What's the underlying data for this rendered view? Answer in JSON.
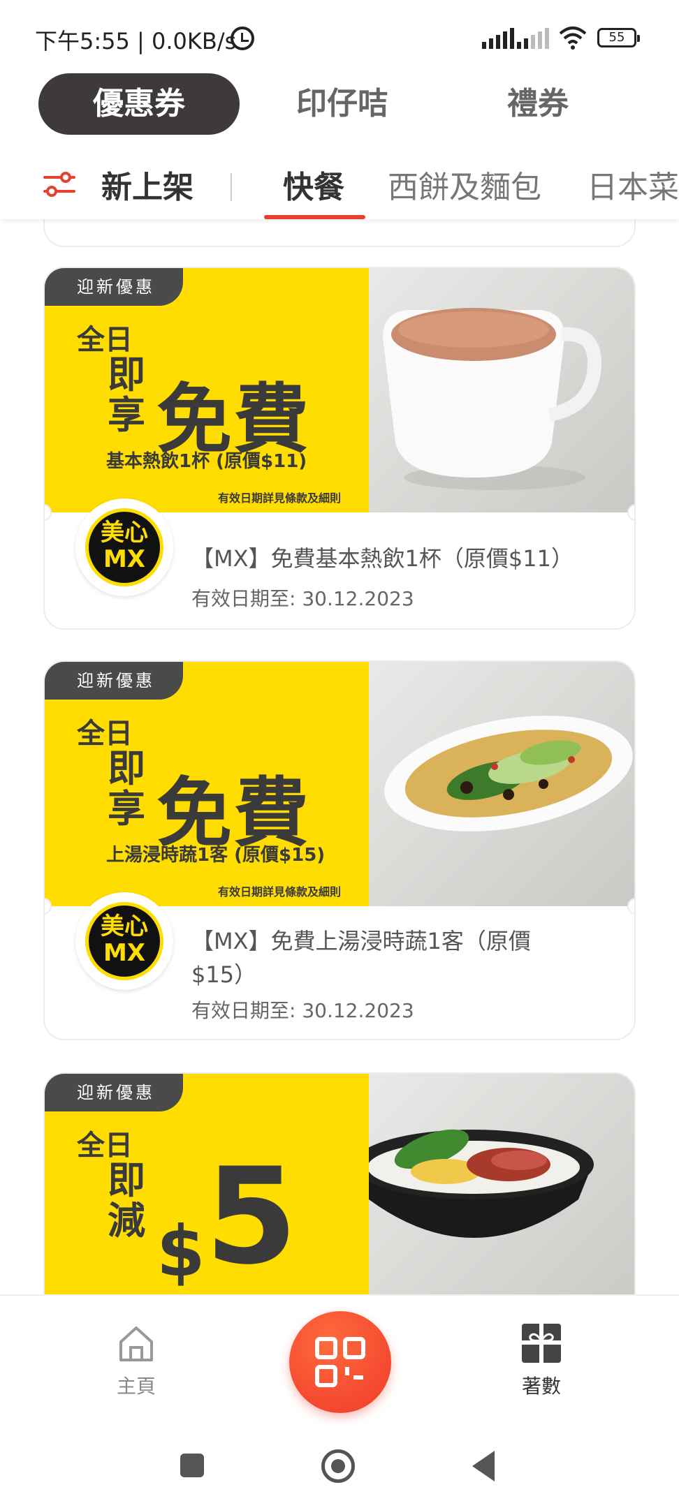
{
  "status_bar": {
    "time_speed": "下午5:55 | 0.0KB/s",
    "battery": "55",
    "icons": [
      "alarm-icon",
      "signal-icon",
      "signal-icon",
      "wifi-icon",
      "battery-icon"
    ]
  },
  "top_tabs": [
    {
      "label": "優惠券",
      "active": true
    },
    {
      "label": "印仔咭",
      "active": false
    },
    {
      "label": "禮券",
      "active": false
    }
  ],
  "categories": {
    "filter_icon": "filter-icon",
    "new": "新上架",
    "items": [
      "快餐",
      "西餅及麵包",
      "日本菜"
    ],
    "active": "快餐"
  },
  "coupons": [
    {
      "tag": "迎新優惠",
      "day": "全日",
      "verb": "即享",
      "headline": "免費",
      "subline": "基本熱飲1杯 (原價$11)",
      "fine_print": "有效日期詳見條款及細則",
      "brand_top": "美心",
      "brand_bottom": "MX",
      "title": "【MX】免費基本熱飲1杯（原價$11）",
      "date": "有效日期至: 30.12.2023"
    },
    {
      "tag": "迎新優惠",
      "day": "全日",
      "verb": "即享",
      "headline": "免費",
      "subline": "上湯浸時蔬1客 (原價$15)",
      "fine_print": "有效日期詳見條款及細則",
      "brand_top": "美心",
      "brand_bottom": "MX",
      "title": "【MX】免費上湯浸時蔬1客（原價$15）",
      "date": "有效日期至: 30.12.2023"
    },
    {
      "tag": "迎新優惠",
      "day": "全日",
      "verb": "即減",
      "currency": "$",
      "amount": "5"
    }
  ],
  "bottom_nav": {
    "home_label": "主頁",
    "scan_icon": "qr-scan-icon",
    "gift_label": "著數"
  },
  "colors": {
    "accent": "#e8412f",
    "brand_yellow": "#ffdd00",
    "dark_tab": "#3d3a39"
  }
}
